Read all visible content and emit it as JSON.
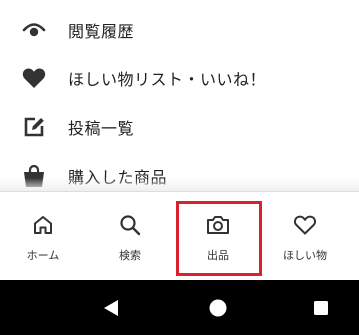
{
  "menu": {
    "items": [
      {
        "icon": "eye-history-icon",
        "label": "閲覧履歴"
      },
      {
        "icon": "heart-icon",
        "label": "ほしい物リスト・いいね！"
      },
      {
        "icon": "edit-post-icon",
        "label": "投稿一覧"
      },
      {
        "icon": "shopping-bag-icon",
        "label": "購入した商品"
      }
    ]
  },
  "tabs": [
    {
      "icon": "home-icon",
      "label": "ホーム"
    },
    {
      "icon": "search-icon",
      "label": "検索"
    },
    {
      "icon": "camera-icon",
      "label": "出品",
      "highlighted": true
    },
    {
      "icon": "heart-outline-icon",
      "label": "ほしい物"
    }
  ],
  "navbar": {
    "back": "back-triangle-icon",
    "home": "home-circle-icon",
    "recents": "recents-square-icon"
  },
  "colors": {
    "highlight": "#d9232c",
    "icon": "#333333",
    "navbar_background": "#000000"
  }
}
